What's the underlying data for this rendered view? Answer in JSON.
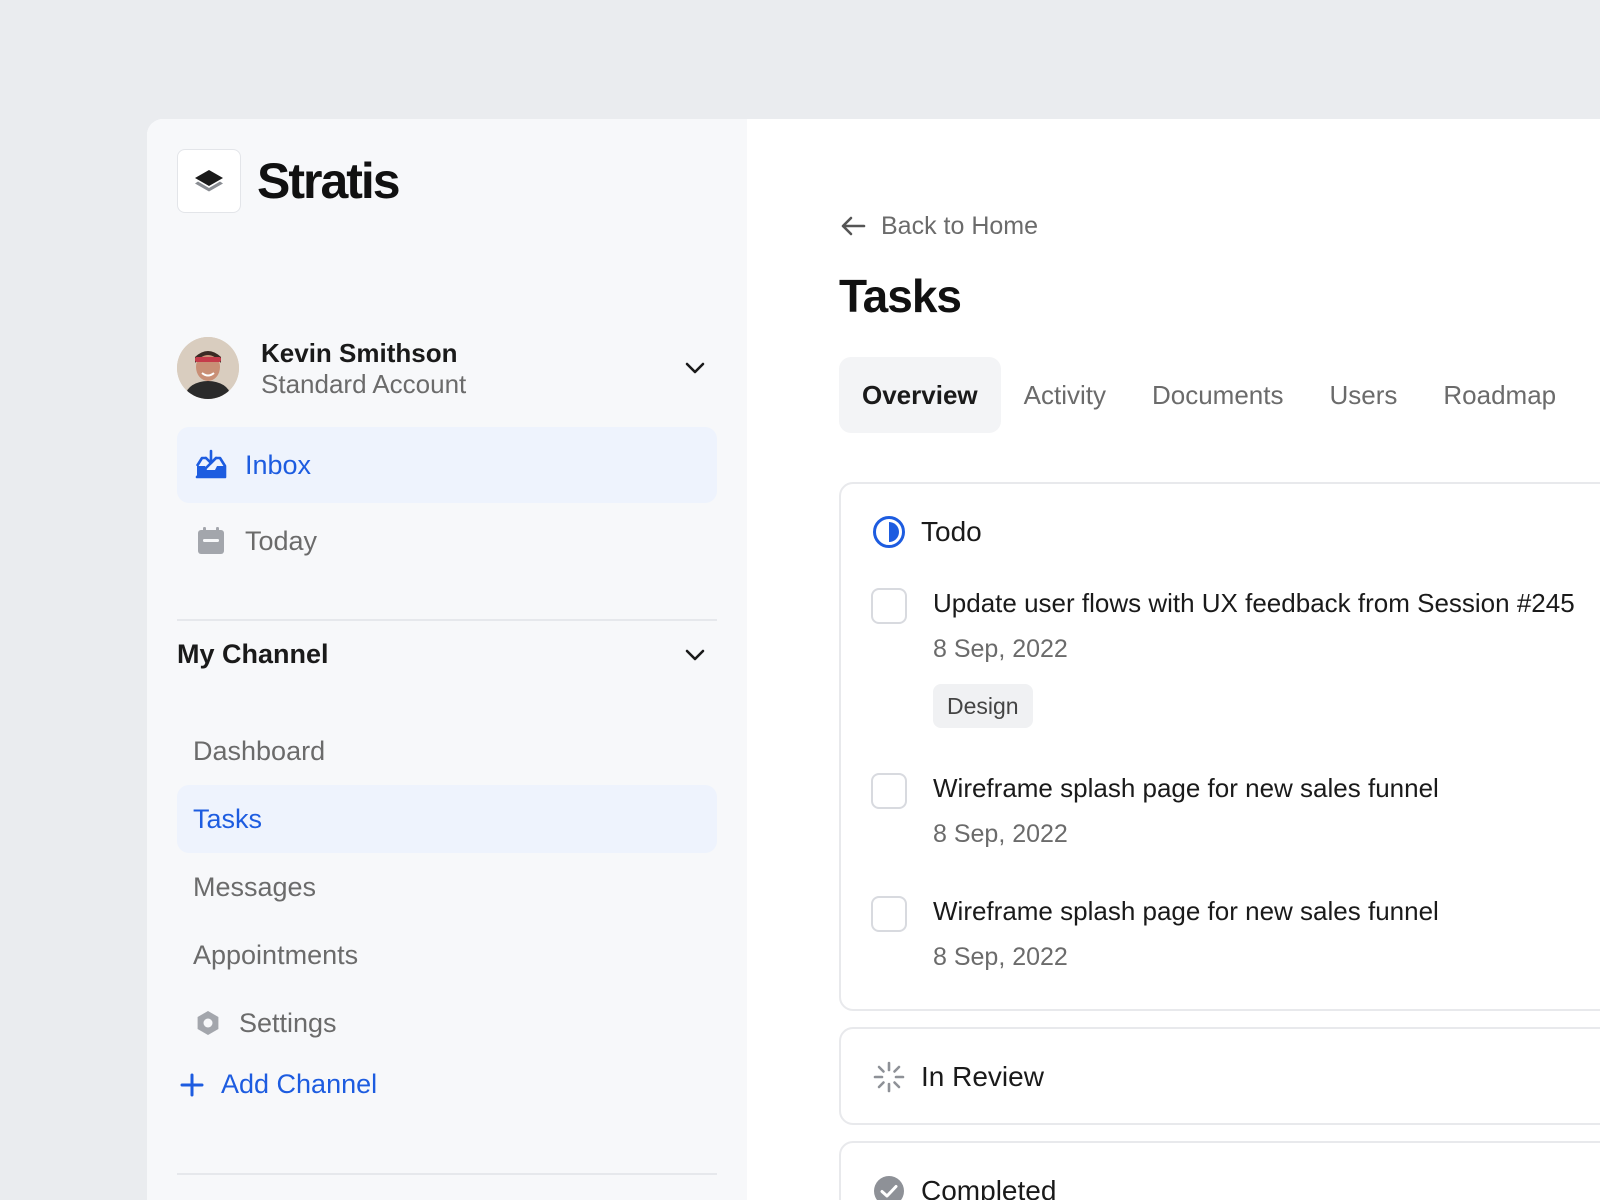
{
  "brand": {
    "name": "Stratis",
    "logo_icon": "layers-icon"
  },
  "user": {
    "name": "Kevin Smithson",
    "account": "Standard Account"
  },
  "nav": [
    {
      "label": "Inbox",
      "icon": "inbox-icon",
      "active": true
    },
    {
      "label": "Today",
      "icon": "calendar-icon",
      "active": false
    }
  ],
  "channel": {
    "title": "My Channel",
    "items": [
      {
        "label": "Dashboard",
        "active": false
      },
      {
        "label": "Tasks",
        "active": true
      },
      {
        "label": "Messages",
        "active": false
      },
      {
        "label": "Appointments",
        "active": false
      },
      {
        "label": "Settings",
        "icon": "gear-icon",
        "active": false
      }
    ],
    "add_label": "Add Channel"
  },
  "main": {
    "back_label": "Back to Home",
    "title": "Tasks",
    "tabs": [
      {
        "label": "Overview",
        "active": true
      },
      {
        "label": "Activity",
        "active": false
      },
      {
        "label": "Documents",
        "active": false
      },
      {
        "label": "Users",
        "active": false
      },
      {
        "label": "Roadmap",
        "active": false
      }
    ],
    "groups": {
      "todo": {
        "label": "Todo",
        "tasks": [
          {
            "title": "Update user flows with UX feedback from Session #245",
            "date": "8 Sep, 2022",
            "tag": "Design"
          },
          {
            "title": "Wireframe splash page for new sales funnel",
            "date": "8 Sep, 2022"
          },
          {
            "title": "Wireframe splash page for new sales funnel",
            "date": "8 Sep, 2022"
          }
        ]
      },
      "review": {
        "label": "In Review"
      },
      "completed": {
        "label": "Completed"
      }
    }
  },
  "colors": {
    "accent": "#1d5ce0",
    "active_bg": "#eef3fd",
    "sidebar_bg": "#f7f8fa",
    "page_bg": "#eaecef"
  }
}
